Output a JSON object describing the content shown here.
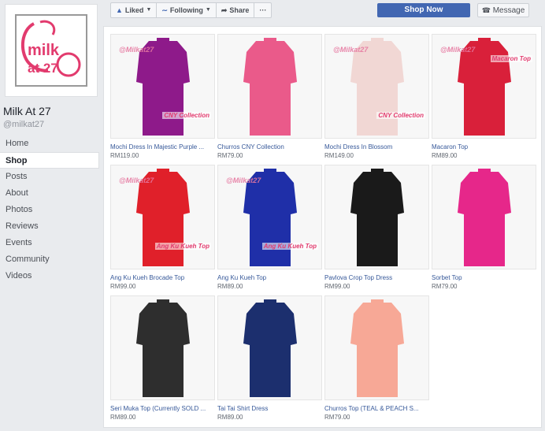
{
  "page": {
    "name": "Milk At 27",
    "handle": "@milkat27",
    "logo_text_1": "milk",
    "logo_text_2": "at 27"
  },
  "nav": [
    "Home",
    "Shop",
    "Posts",
    "About",
    "Photos",
    "Reviews",
    "Events",
    "Community",
    "Videos"
  ],
  "toolbar": {
    "liked": "Liked",
    "following": "Following",
    "share": "Share",
    "more": "···",
    "shop_now": "Shop Now",
    "message": "Message"
  },
  "products": [
    {
      "title": "Mochi Dress In Majestic Purple ...",
      "price": "RM119.00",
      "color": "#8e1a8a",
      "watermark": "@Milkat27",
      "tag": "CNY Collection"
    },
    {
      "title": "Churros CNY Collection",
      "price": "RM79.00",
      "color": "#ea5a8a",
      "watermark": "",
      "tag": ""
    },
    {
      "title": "Mochi Dress In Blossom",
      "price": "RM149.00",
      "color": "#f1d7d4",
      "watermark": "@Milkat27",
      "tag": "CNY Collection"
    },
    {
      "title": "Macaron Top",
      "price": "RM89.00",
      "color": "#d9203a",
      "watermark": "@Milkat27",
      "tag": "Macaron Top"
    },
    {
      "title": "Ang Ku Kueh Brocade Top",
      "price": "RM99.00",
      "color": "#e0202a",
      "watermark": "@Milkat27",
      "tag": "Ang Ku Kueh Top"
    },
    {
      "title": "Ang Ku Kueh Top",
      "price": "RM89.00",
      "color": "#1f2fa8",
      "watermark": "@Milkat27",
      "tag": "Ang Ku Kueh Top"
    },
    {
      "title": "Pavlova Crop Top Dress",
      "price": "RM99.00",
      "color": "#1a1a1a",
      "watermark": "",
      "tag": ""
    },
    {
      "title": "Sorbet Top",
      "price": "RM79.00",
      "color": "#e6278a",
      "watermark": "",
      "tag": ""
    },
    {
      "title": "Seri Muka Top (Currently SOLD ...",
      "price": "RM89.00",
      "color": "#2e2e2e",
      "watermark": "",
      "tag": ""
    },
    {
      "title": "Tai Tai Shirt Dress",
      "price": "RM89.00",
      "color": "#1c2f6e",
      "watermark": "",
      "tag": ""
    },
    {
      "title": "Churros Top (TEAL & PEACH S...",
      "price": "RM79.00",
      "color": "#f7a896",
      "watermark": "",
      "tag": ""
    }
  ],
  "colors": {
    "accent": "#4267b2",
    "link": "#365899",
    "brand_pink": "#e23b6e"
  }
}
